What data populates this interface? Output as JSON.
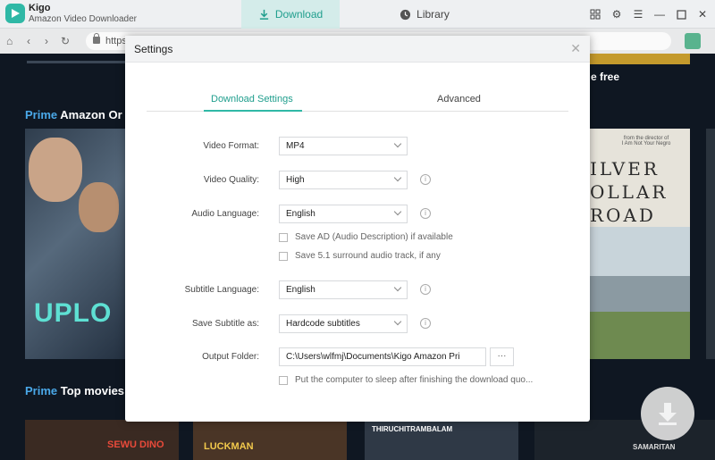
{
  "app": {
    "name": "Kigo",
    "subtitle": "Amazon Video Downloader"
  },
  "tabs": {
    "download": "Download",
    "library": "Library"
  },
  "window_controls": [
    "grid-icon",
    "gear-icon",
    "menu-icon",
    "minimize-icon",
    "maximize-icon",
    "close-icon"
  ],
  "browser": {
    "url": "https"
  },
  "background": {
    "row1_prime": "Prime",
    "row1_title": "Amazon Or",
    "row2_prime": "Prime",
    "row2_title": "Top movies",
    "free_text": "e free",
    "poster_left_text": "UPLO",
    "poster_right_small": "from the director of\nI Am Not Your Negro",
    "poster_right_title": "ILVER\nOLLAR\nROAD",
    "bottom_posters": [
      "SEWU DINO",
      "LUCKMAN",
      "THIRUCHITRAMBALAM",
      "SAMARITAN"
    ]
  },
  "settings": {
    "title": "Settings",
    "tabs": {
      "active": "Download Settings",
      "advanced": "Advanced"
    },
    "video_format": {
      "label": "Video Format:",
      "value": "MP4"
    },
    "video_quality": {
      "label": "Video Quality:",
      "value": "High"
    },
    "audio_language": {
      "label": "Audio Language:",
      "value": "English"
    },
    "save_ad": "Save AD (Audio Description) if available",
    "save_51": "Save 5.1 surround audio track, if any",
    "subtitle_language": {
      "label": "Subtitle Language:",
      "value": "English"
    },
    "save_subtitle_as": {
      "label": "Save Subtitle as:",
      "value": "Hardcode subtitles"
    },
    "output_folder": {
      "label": "Output Folder:",
      "value": "C:\\Users\\wlfmj\\Documents\\Kigo Amazon Pri",
      "browse": "···"
    },
    "sleep_option": "Put the computer to sleep after finishing the download quo..."
  },
  "colors": {
    "accent": "#2fb8a6",
    "prime_blue": "#4aa8e8"
  }
}
